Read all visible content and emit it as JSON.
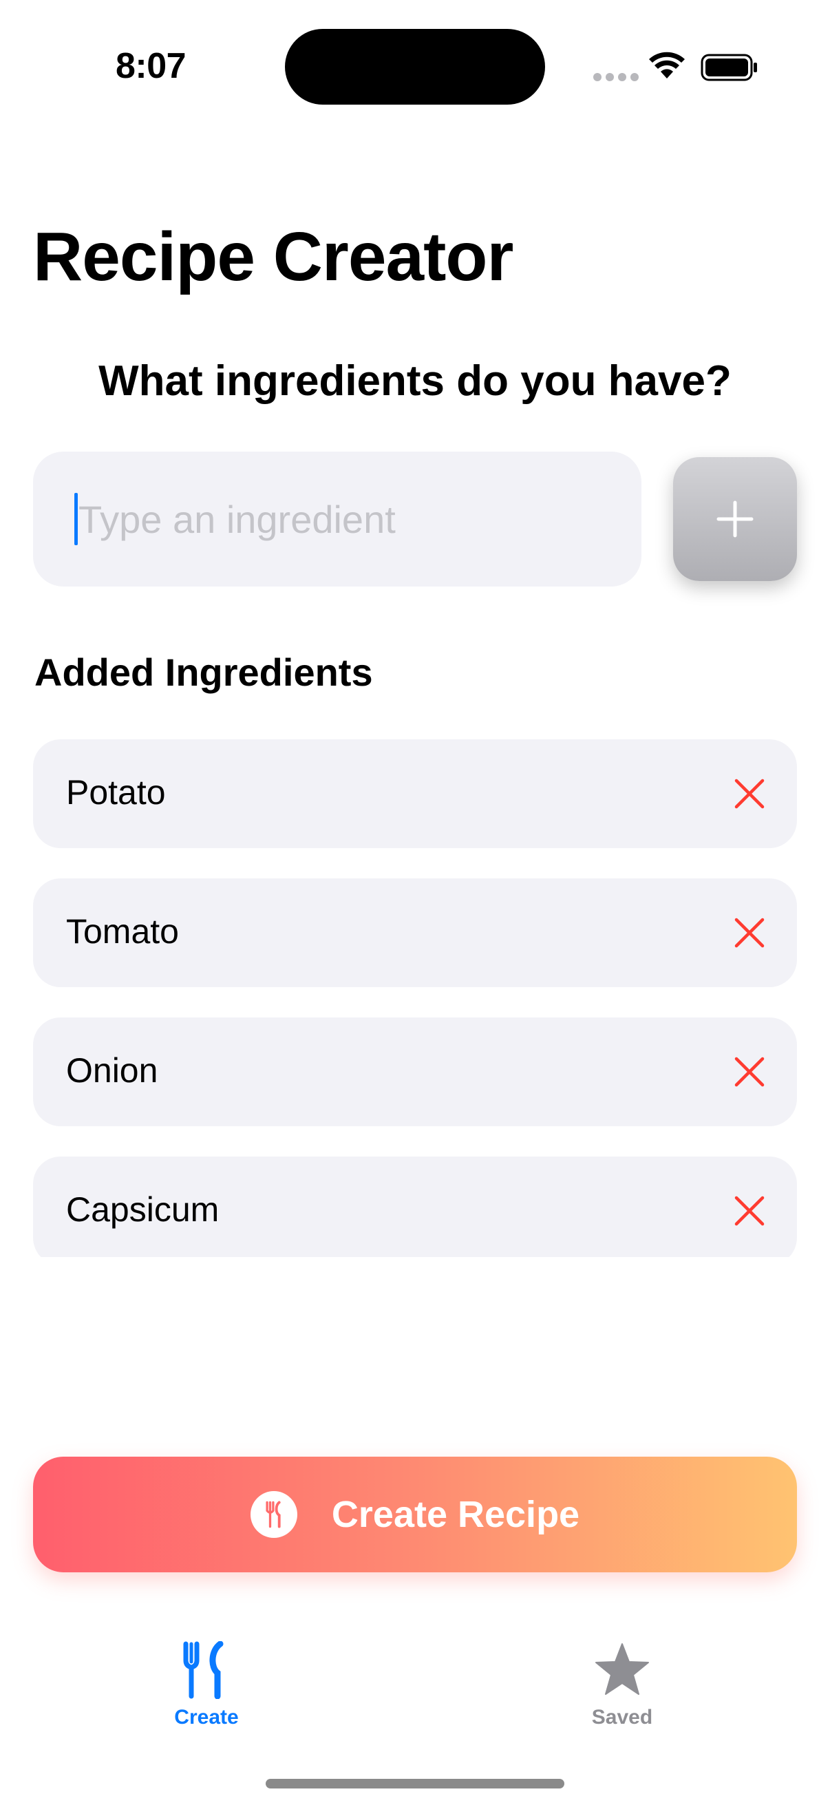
{
  "status_bar": {
    "time": "8:07"
  },
  "header": {
    "title": "Recipe Creator"
  },
  "prompt": {
    "heading": "What ingredients do you have?"
  },
  "ingredient_input": {
    "placeholder": "Type an ingredient",
    "value": "",
    "add_button_icon": "plus-icon"
  },
  "ingredients_section": {
    "title": "Added Ingredients",
    "items": [
      {
        "name": "Potato",
        "remove_icon": "close-icon"
      },
      {
        "name": "Tomato",
        "remove_icon": "close-icon"
      },
      {
        "name": "Onion",
        "remove_icon": "close-icon"
      },
      {
        "name": "Capsicum",
        "remove_icon": "close-icon"
      }
    ]
  },
  "create_button": {
    "label": "Create Recipe",
    "icon": "fork-knife-icon"
  },
  "tab_bar": {
    "tabs": [
      {
        "label": "Create",
        "icon": "fork-knife-icon",
        "selected": true
      },
      {
        "label": "Saved",
        "icon": "star-icon",
        "selected": false
      }
    ]
  },
  "colors": {
    "accent": "#0a7aff",
    "remove": "#ff3b30",
    "gradient_start": "#ff5f6d",
    "gradient_end": "#ffc371",
    "inactive_tab": "#8e8e93",
    "field_background": "#f2f2f7"
  }
}
